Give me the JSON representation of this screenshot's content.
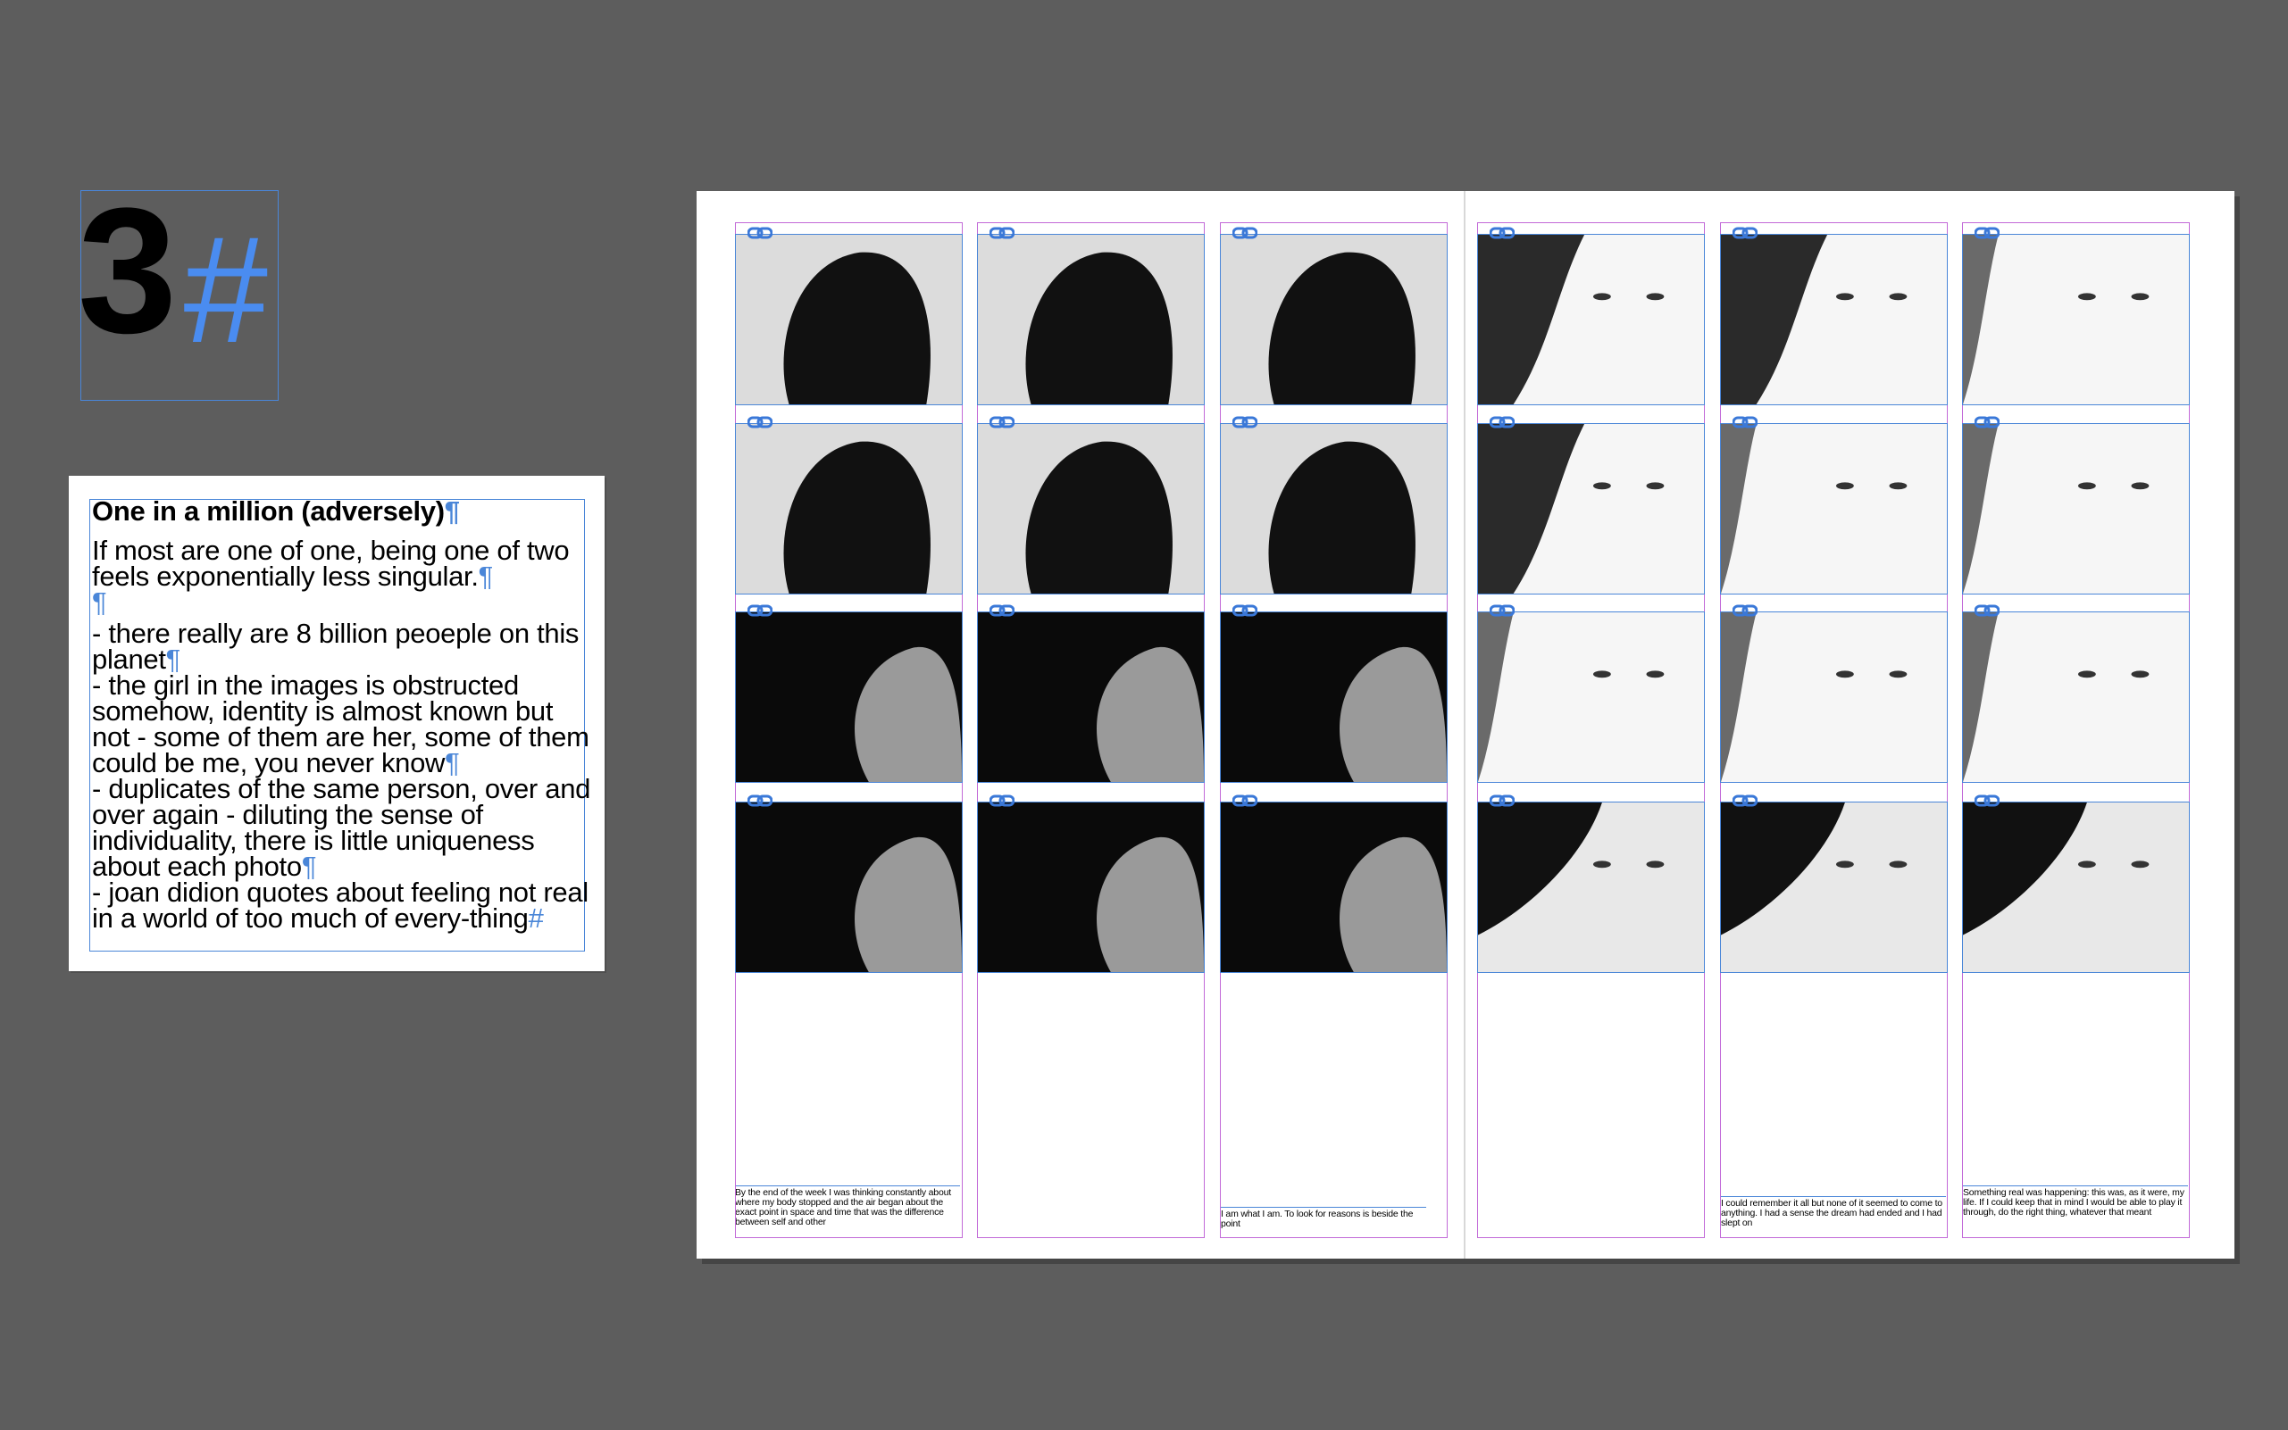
{
  "number_tile": {
    "digit": "3",
    "symbol": "#"
  },
  "text_card": {
    "title": "One in a million (adversely)",
    "paragraphs": [
      "If most are one of one, being one of two feels exponentially less singular.",
      "",
      "- there really are 8 billion peoeple on this planet",
      "- the girl in the images is obstructed somehow, identity is almost known but not - some of them are her, some of them could be me, you never know",
      "- duplicates of the same person, over and over again - diluting the sense of individuality, there is little uniqueness about each photo",
      "- joan didion quotes about feeling not real in a world of too much of every-thing"
    ],
    "pilcrow": "¶",
    "end_mark": "#"
  },
  "captions": {
    "col1": "By the end of the week I was thinking constantly about where my body stopped and the air began about the exact point in space and time that was the difference between self and other",
    "col3": "I am what I am. To look for reasons is beside the point",
    "col5": "I could remember it all but none of it seemed to come to anything. I had a sense the dream had ended and I had slept on",
    "col6": "Something real was happening: this was, as it were, my life. If I could keep that in mind I would be able to play it through, do the right thing, whatever that meant"
  },
  "colors": {
    "background": "#5d5d5d",
    "frame": "#4a86d8",
    "guide": "#c26ad8",
    "accent": "#4a8cf0"
  },
  "icons": {
    "link": "link-icon",
    "pilcrow": "pilcrow-mark"
  }
}
